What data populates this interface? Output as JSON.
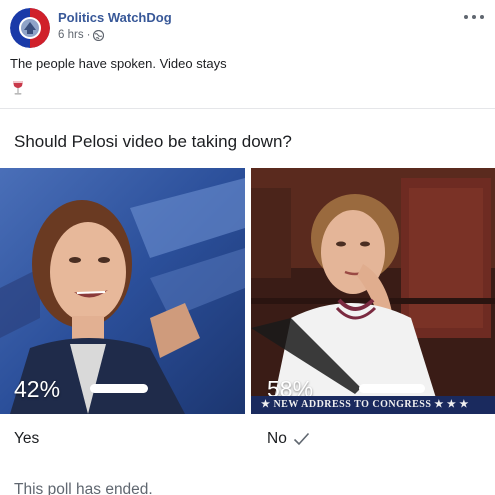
{
  "post": {
    "page_name": "Politics WatchDog",
    "time": "6 hrs",
    "separator": "·",
    "privacy_icon": "globe-icon",
    "text": "The people have spoken. Video stays",
    "emoji_icon": "wine-glass-icon"
  },
  "poll": {
    "question": "Should Pelosi video be taking down?",
    "options": [
      {
        "label": "Yes",
        "percent_text": "42%",
        "percent": 42
      },
      {
        "label": "No",
        "percent_text": "58%",
        "percent": 58,
        "chyron": "★ NEW ADDRESS TO CONGRESS ★ ★ ★",
        "selected": true
      }
    ],
    "status": "This poll has ended."
  },
  "colors": {
    "link": "#385898",
    "secondary_text": "#606770",
    "divider": "#e5e6e9",
    "avatar_blue": "#1a3aa8",
    "avatar_red": "#d0202a"
  }
}
